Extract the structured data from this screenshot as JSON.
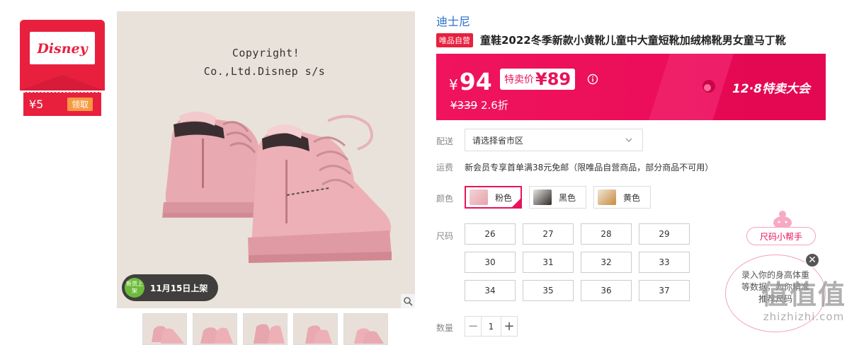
{
  "coupon": {
    "logo_text": "DISNEY",
    "amount": "¥5",
    "claim_label": "领取"
  },
  "gallery": {
    "watermark_line1": "Copyright!",
    "watermark_line2": "Co.,Ltd.Disnep s/s",
    "new_badge": "新货上架",
    "listed_text": "11月15日上架",
    "thumbnail_count": 5
  },
  "product": {
    "brand": "迪士尼",
    "self_operated_tag": "唯品自营",
    "title": "童鞋2022冬季新款小黄靴儿童中大童短靴加绒棉靴男女童马丁靴"
  },
  "price": {
    "currency": "¥",
    "current": "94",
    "special_label": "特卖价",
    "special_price": "¥89",
    "original": "¥339",
    "discount": "2.6折",
    "promo_name": "12·8特卖大会",
    "accent_color": "#e8135a"
  },
  "delivery": {
    "label": "配送",
    "placeholder": "请选择省市区"
  },
  "freight": {
    "label": "运费",
    "text": "新会员专享首单满38元免邮（限唯品自营商品，部分商品不可用）"
  },
  "colors": {
    "label": "颜色",
    "options": [
      {
        "name": "粉色",
        "selected": true
      },
      {
        "name": "黑色",
        "selected": false
      },
      {
        "name": "黄色",
        "selected": false
      }
    ]
  },
  "sizes": {
    "label": "尺码",
    "options": [
      "26",
      "27",
      "28",
      "29",
      "30",
      "31",
      "32",
      "33",
      "34",
      "35",
      "36",
      "37"
    ]
  },
  "quantity": {
    "label": "数量",
    "value": "1",
    "minus": "−",
    "plus": "+"
  },
  "size_helper": {
    "label": "尺码小帮手",
    "bubble_text": "录入你的身高体重等数据，为你精准推荐尺码",
    "close": "✕"
  },
  "site_watermark": {
    "big": "值值值",
    "small": "zhizhizhi.com"
  }
}
